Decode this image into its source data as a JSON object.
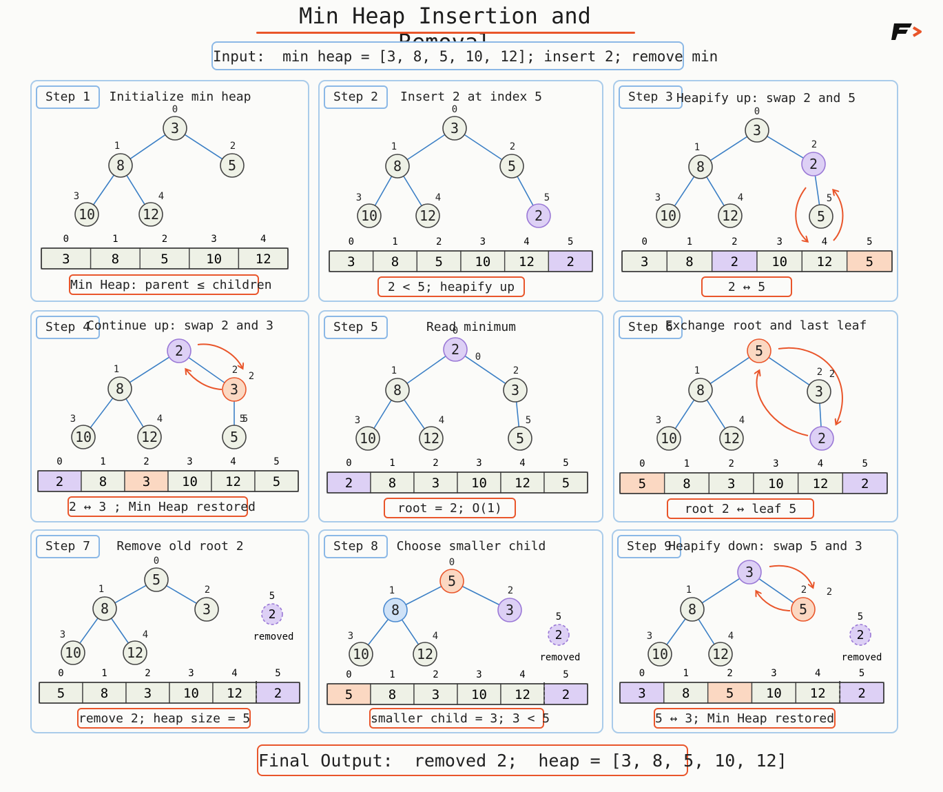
{
  "title": "Min Heap Insertion and Removal",
  "input": "Input:  min heap = [3, 8, 5, 10, 12]; insert 2; remove min",
  "final": "Final Output:  removed 2;  heap = [3, 8, 5, 10, 12]",
  "colors": {
    "plain": "#eef1e6",
    "purple": "#ddd0f5",
    "orange": "#fbd8c2",
    "blue": "#cfe2f7",
    "accent": "#e9552a",
    "edge": "#3b7fc5",
    "panelBorder": "#a9cbea"
  },
  "steps": [
    {
      "label": "Step 1",
      "title": "Initialize min heap",
      "caption": "Min Heap: parent ≤ children",
      "nodes": [
        {
          "i": "0",
          "v": "3"
        },
        {
          "i": "1",
          "v": "8"
        },
        {
          "i": "2",
          "v": "5"
        },
        {
          "i": "3",
          "v": "10"
        },
        {
          "i": "4",
          "v": "12"
        }
      ],
      "array": [
        {
          "i": "0",
          "v": "3"
        },
        {
          "i": "1",
          "v": "8"
        },
        {
          "i": "2",
          "v": "5"
        },
        {
          "i": "3",
          "v": "10"
        },
        {
          "i": "4",
          "v": "12"
        }
      ]
    },
    {
      "label": "Step 2",
      "title": "Insert 2 at index 5",
      "caption": "2 < 5; heapify up",
      "nodes": [
        {
          "i": "0",
          "v": "3"
        },
        {
          "i": "1",
          "v": "8"
        },
        {
          "i": "2",
          "v": "5"
        },
        {
          "i": "3",
          "v": "10"
        },
        {
          "i": "4",
          "v": "12"
        },
        {
          "i": "5",
          "v": "2",
          "c": "purple"
        }
      ],
      "array": [
        {
          "i": "0",
          "v": "3"
        },
        {
          "i": "1",
          "v": "8"
        },
        {
          "i": "2",
          "v": "5"
        },
        {
          "i": "3",
          "v": "10"
        },
        {
          "i": "4",
          "v": "12"
        },
        {
          "i": "5",
          "v": "2",
          "c": "purple"
        }
      ]
    },
    {
      "label": "Step 3",
      "title": "Heapify up: swap 2 and 5",
      "caption": "2 ↔ 5",
      "nodes": [
        {
          "i": "0",
          "v": "3"
        },
        {
          "i": "1",
          "v": "8"
        },
        {
          "i": "2",
          "v": "2",
          "c": "purple"
        },
        {
          "i": "3",
          "v": "10"
        },
        {
          "i": "4",
          "v": "12"
        },
        {
          "i": "5",
          "v": "5"
        }
      ],
      "array": [
        {
          "i": "0",
          "v": "3"
        },
        {
          "i": "1",
          "v": "8"
        },
        {
          "i": "2",
          "v": "2",
          "c": "purple"
        },
        {
          "i": "3",
          "v": "10"
        },
        {
          "i": "4",
          "v": "12"
        },
        {
          "i": "5",
          "v": "5",
          "c": "orange"
        }
      ]
    },
    {
      "label": "Step 4",
      "title": "Continue up: swap 2 and 3",
      "caption": "2 ↔ 3 ; Min Heap restored",
      "nodes": [
        {
          "i": "",
          "v": "2",
          "c": "purple"
        },
        {
          "i": "1",
          "v": "8"
        },
        {
          "i": "2",
          "v": "3",
          "c": "orange"
        },
        {
          "i": "3",
          "v": "10"
        },
        {
          "i": "4",
          "v": "12"
        },
        {
          "i": "5",
          "v": "5"
        }
      ],
      "array": [
        {
          "i": "0",
          "v": "2",
          "c": "purple"
        },
        {
          "i": "1",
          "v": "8"
        },
        {
          "i": "2",
          "v": "3",
          "c": "orange"
        },
        {
          "i": "3",
          "v": "10"
        },
        {
          "i": "4",
          "v": "12"
        },
        {
          "i": "5",
          "v": "5"
        }
      ]
    },
    {
      "label": "Step 5",
      "title": "Read minimum",
      "caption": "root = 2; O(1)",
      "nodes": [
        {
          "i": "0",
          "v": "2",
          "c": "purple"
        },
        {
          "i": "1",
          "v": "8"
        },
        {
          "i": "2",
          "v": "3"
        },
        {
          "i": "3",
          "v": "10"
        },
        {
          "i": "4",
          "v": "12"
        },
        {
          "i": "5",
          "v": "5"
        }
      ],
      "array": [
        {
          "i": "0",
          "v": "2",
          "c": "purple"
        },
        {
          "i": "1",
          "v": "8"
        },
        {
          "i": "2",
          "v": "3"
        },
        {
          "i": "3",
          "v": "10"
        },
        {
          "i": "4",
          "v": "12"
        },
        {
          "i": "5",
          "v": "5"
        }
      ]
    },
    {
      "label": "Step 6",
      "title": "Exchange root and last leaf",
      "caption": "root 2 ↔ leaf 5",
      "nodes": [
        {
          "i": "",
          "v": "5",
          "c": "orange"
        },
        {
          "i": "1",
          "v": "8"
        },
        {
          "i": "2",
          "v": "3"
        },
        {
          "i": "3",
          "v": "10"
        },
        {
          "i": "4",
          "v": "12"
        },
        {
          "i": "",
          "v": "2",
          "c": "purple"
        }
      ],
      "array": [
        {
          "i": "0",
          "v": "5",
          "c": "orange"
        },
        {
          "i": "1",
          "v": "8"
        },
        {
          "i": "2",
          "v": "3"
        },
        {
          "i": "3",
          "v": "10"
        },
        {
          "i": "4",
          "v": "12"
        },
        {
          "i": "5",
          "v": "2",
          "c": "purple"
        }
      ]
    },
    {
      "label": "Step 7",
      "title": "Remove old root 2",
      "caption": "remove 2; heap size = 5",
      "nodes": [
        {
          "i": "0",
          "v": "5"
        },
        {
          "i": "1",
          "v": "8"
        },
        {
          "i": "2",
          "v": "3"
        },
        {
          "i": "3",
          "v": "10"
        },
        {
          "i": "4",
          "v": "12"
        }
      ],
      "removed": {
        "i": "5",
        "v": "2",
        "text": "removed"
      },
      "array": [
        {
          "i": "0",
          "v": "5"
        },
        {
          "i": "1",
          "v": "8"
        },
        {
          "i": "2",
          "v": "3"
        },
        {
          "i": "3",
          "v": "10"
        },
        {
          "i": "4",
          "v": "12"
        },
        {
          "i": "5",
          "v": "2",
          "c": "purple",
          "removed": true
        }
      ]
    },
    {
      "label": "Step 8",
      "title": "Choose smaller child",
      "caption": "smaller child = 3; 3 < 5",
      "nodes": [
        {
          "i": "0",
          "v": "5",
          "c": "orange"
        },
        {
          "i": "1",
          "v": "8",
          "c": "blue"
        },
        {
          "i": "2",
          "v": "3",
          "c": "purple"
        },
        {
          "i": "3",
          "v": "10"
        },
        {
          "i": "4",
          "v": "12"
        }
      ],
      "removed": {
        "i": "5",
        "v": "2",
        "text": "removed"
      },
      "array": [
        {
          "i": "0",
          "v": "5",
          "c": "orange"
        },
        {
          "i": "1",
          "v": "8"
        },
        {
          "i": "2",
          "v": "3"
        },
        {
          "i": "3",
          "v": "10"
        },
        {
          "i": "4",
          "v": "12"
        },
        {
          "i": "5",
          "v": "2",
          "c": "purple",
          "removed": true
        }
      ]
    },
    {
      "label": "Step 9",
      "title": "Heapify down: swap 5 and 3",
      "caption": "5 ↔ 3; Min Heap restored",
      "nodes": [
        {
          "i": "",
          "v": "3",
          "c": "purple"
        },
        {
          "i": "1",
          "v": "8"
        },
        {
          "i": "2",
          "v": "5",
          "c": "orange"
        },
        {
          "i": "3",
          "v": "10"
        },
        {
          "i": "4",
          "v": "12"
        }
      ],
      "removed": {
        "i": "5",
        "v": "2",
        "text": "removed"
      },
      "array": [
        {
          "i": "0",
          "v": "3",
          "c": "purple"
        },
        {
          "i": "1",
          "v": "8"
        },
        {
          "i": "2",
          "v": "5",
          "c": "orange"
        },
        {
          "i": "3",
          "v": "10"
        },
        {
          "i": "4",
          "v": "12"
        },
        {
          "i": "5",
          "v": "2",
          "c": "purple",
          "removed": true
        }
      ]
    }
  ]
}
